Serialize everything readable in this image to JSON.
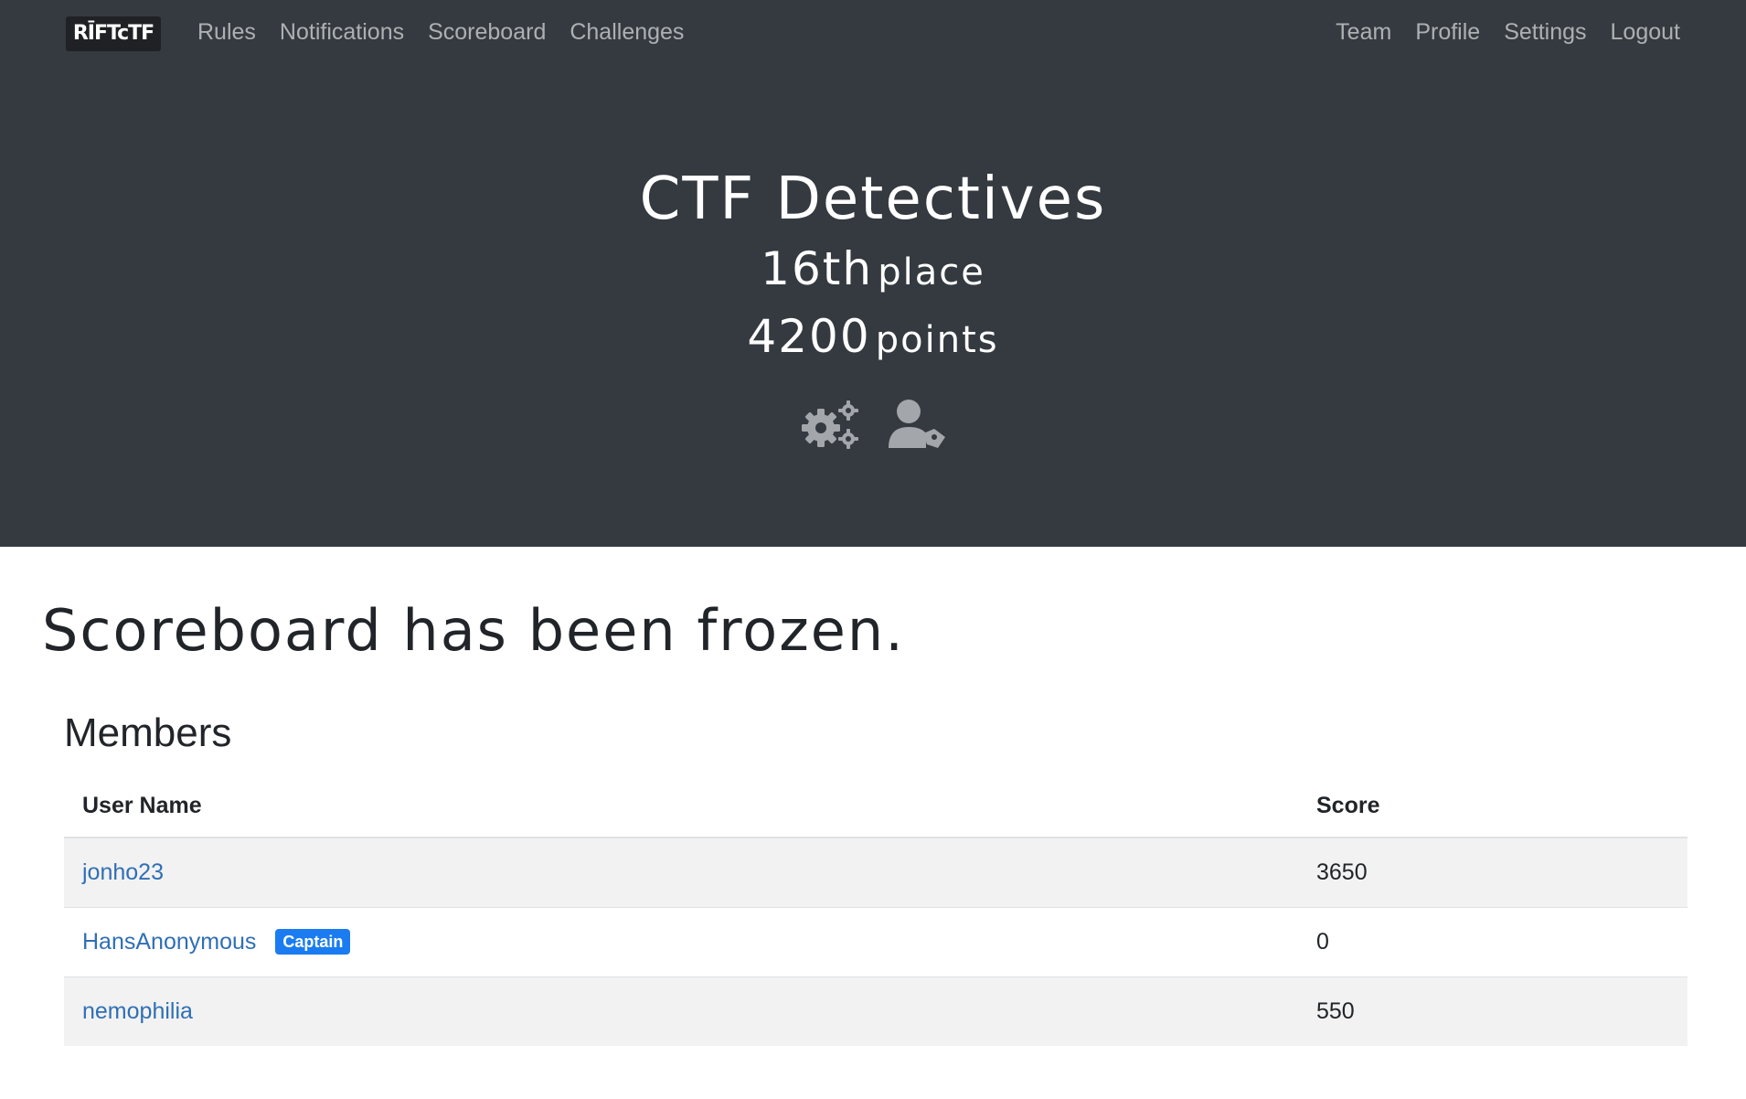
{
  "nav": {
    "brand": "RĪFTcTF",
    "left": [
      "Rules",
      "Notifications",
      "Scoreboard",
      "Challenges"
    ],
    "right": [
      "Team",
      "Profile",
      "Settings",
      "Logout"
    ]
  },
  "team": {
    "name": "CTF Detectives",
    "place_num": "16th",
    "place_label": "place",
    "points_num": "4200",
    "points_label": "points",
    "icons": [
      "gears-icon",
      "user-tag-icon"
    ]
  },
  "notice": "Scoreboard has been frozen.",
  "members": {
    "title": "Members",
    "columns": [
      "User Name",
      "Score"
    ],
    "rows": [
      {
        "name": "jonho23",
        "badge": "",
        "score": "3650"
      },
      {
        "name": "HansAnonymous",
        "badge": "Captain",
        "score": "0"
      },
      {
        "name": "nemophilia",
        "badge": "",
        "score": "550"
      }
    ]
  },
  "colors": {
    "dark_bg": "#343a40",
    "link": "#2f6fb5",
    "badge": "#1a7cf0"
  }
}
